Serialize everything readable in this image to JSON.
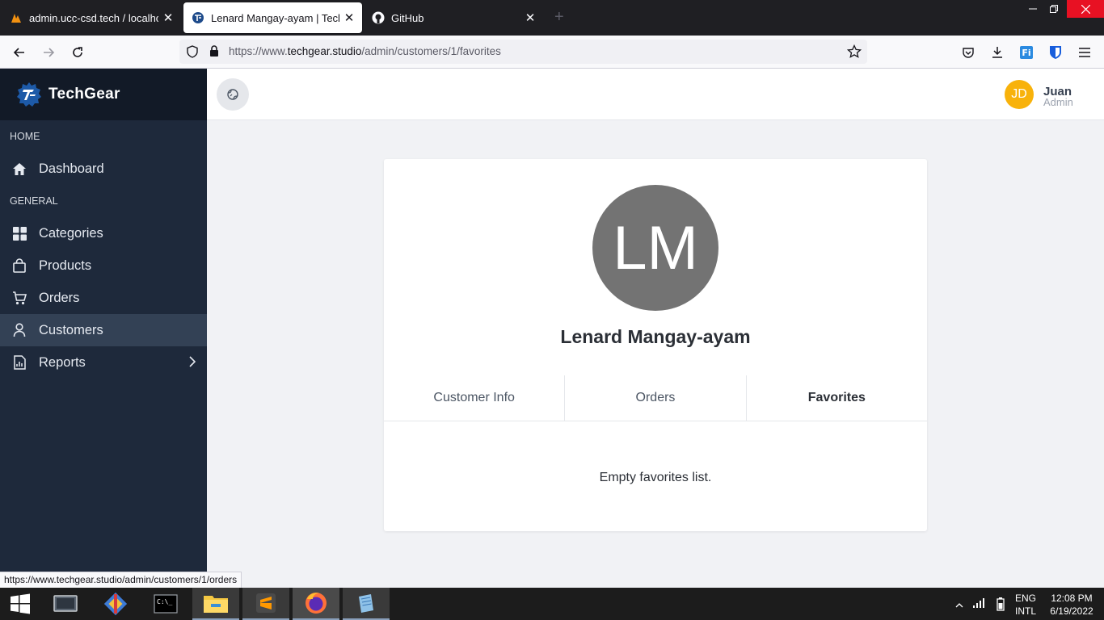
{
  "browser": {
    "tabs": [
      {
        "title": "admin.ucc-csd.tech / localhost",
        "icon": "phpmyadmin-icon"
      },
      {
        "title": "Lenard Mangay-ayam | TechGear",
        "icon": "techgear-icon"
      },
      {
        "title": "GitHub",
        "icon": "github-icon"
      }
    ],
    "new_tab": "+",
    "url_prefix": "https://www.",
    "url_domain": "techgear.studio",
    "url_path": "/admin/customers/1/favorites"
  },
  "sidebar": {
    "brand": "TechGear",
    "sections": {
      "home": "HOME",
      "general": "GENERAL"
    },
    "items": [
      {
        "label": "Dashboard",
        "icon": "home-icon"
      },
      {
        "label": "Categories",
        "icon": "grid-icon"
      },
      {
        "label": "Products",
        "icon": "shopping-bag-icon"
      },
      {
        "label": "Orders",
        "icon": "cart-icon"
      },
      {
        "label": "Customers",
        "icon": "user-icon",
        "active": true
      },
      {
        "label": "Reports",
        "icon": "report-icon"
      }
    ]
  },
  "header": {
    "user": {
      "initials": "JD",
      "name": "Juan",
      "role": "Admin",
      "avatar_color": "#f8b20b"
    }
  },
  "customer": {
    "initials": "LM",
    "name": "Lenard Mangay-ayam",
    "tabs": [
      {
        "label": "Customer Info"
      },
      {
        "label": "Orders"
      },
      {
        "label": "Favorites",
        "active": true
      }
    ],
    "empty_message": "Empty favorites list."
  },
  "status_link": "https://www.techgear.studio/admin/customers/1/orders",
  "taskbar": {
    "lang": "ENG",
    "layout": "INTL",
    "time": "12:08 PM",
    "date": "6/19/2022"
  },
  "colors": {
    "sidebar": "#1e293b",
    "sidebar_active": "#334155",
    "brand_bg": "#121a27",
    "avatar_gray": "#737373"
  }
}
